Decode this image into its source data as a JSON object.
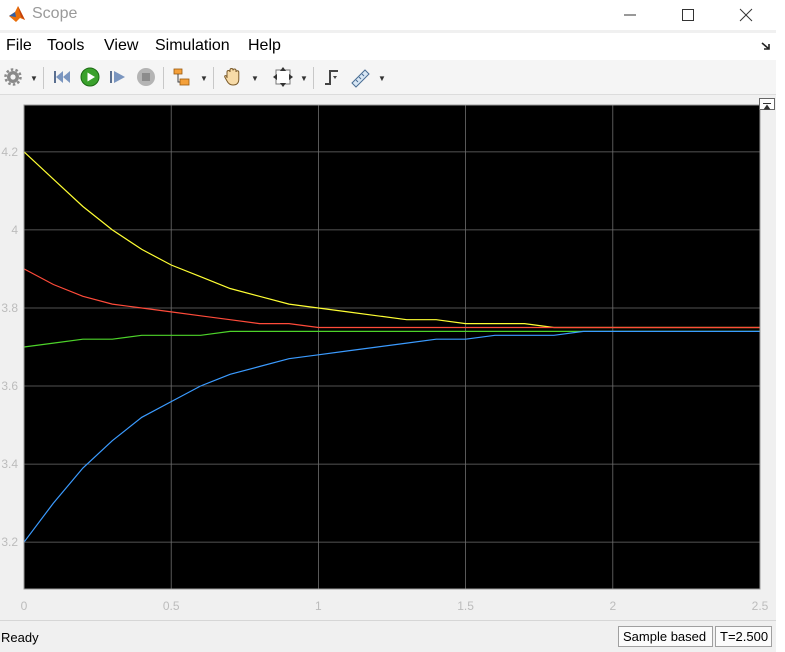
{
  "window": {
    "title": "Scope",
    "icons": {
      "app": "matlab-logo-icon",
      "minimize": "minimize-icon",
      "maximize": "maximize-icon",
      "close": "close-icon"
    }
  },
  "menu": {
    "items": [
      "File",
      "Tools",
      "View",
      "Simulation",
      "Help"
    ],
    "corner_icon": "dock-arrow-icon"
  },
  "toolbar": {
    "buttons": [
      "settings-gear-icon",
      "step-back-icon",
      "run-icon",
      "step-forward-icon",
      "stop-icon",
      "highlight-simulink-block-icon",
      "zoom-pan-hand-icon",
      "scale-axes-limits-icon",
      "triggers-icon",
      "measurements-ruler-icon"
    ]
  },
  "colors": {
    "plot_background": "#000000",
    "grid": "#6e6e6e",
    "tick_label": "#bcbcbc",
    "series": [
      "#ffff33",
      "#ff4b3a",
      "#4dd32a",
      "#3b9bff"
    ]
  },
  "chart_data": {
    "type": "line",
    "grid": true,
    "xlim": [
      0,
      2.5
    ],
    "ylim": [
      3.08,
      4.32
    ],
    "xticks": [
      0,
      0.5,
      1,
      1.5,
      2,
      2.5
    ],
    "xtick_labels": [
      "0",
      "0.5",
      "1",
      "1.5",
      "2",
      "2.5"
    ],
    "yticks": [
      3.2,
      3.4,
      3.6,
      3.8,
      4,
      4.2
    ],
    "ytick_labels": [
      "3.2",
      "3.4",
      "3.6",
      "3.8",
      "4",
      "4.2"
    ],
    "x": [
      0,
      0.1,
      0.2,
      0.3,
      0.4,
      0.5,
      0.6,
      0.7,
      0.8,
      0.9,
      1.0,
      1.1,
      1.2,
      1.3,
      1.4,
      1.5,
      1.6,
      1.7,
      1.8,
      1.9,
      2.0,
      2.1,
      2.2,
      2.3,
      2.4,
      2.5
    ],
    "series": [
      {
        "color": "#ffff33",
        "values": [
          4.2,
          4.13,
          4.06,
          4.0,
          3.95,
          3.91,
          3.88,
          3.85,
          3.83,
          3.81,
          3.8,
          3.79,
          3.78,
          3.77,
          3.77,
          3.76,
          3.76,
          3.76,
          3.75,
          3.75,
          3.75,
          3.75,
          3.75,
          3.75,
          3.75,
          3.75
        ]
      },
      {
        "color": "#ff4b3a",
        "values": [
          3.9,
          3.86,
          3.83,
          3.81,
          3.8,
          3.79,
          3.78,
          3.77,
          3.76,
          3.76,
          3.75,
          3.75,
          3.75,
          3.75,
          3.75,
          3.75,
          3.75,
          3.75,
          3.75,
          3.75,
          3.75,
          3.75,
          3.75,
          3.75,
          3.75,
          3.75
        ]
      },
      {
        "color": "#4dd32a",
        "values": [
          3.7,
          3.71,
          3.72,
          3.72,
          3.73,
          3.73,
          3.73,
          3.74,
          3.74,
          3.74,
          3.74,
          3.74,
          3.74,
          3.74,
          3.74,
          3.74,
          3.74,
          3.74,
          3.74,
          3.74,
          3.74,
          3.74,
          3.74,
          3.74,
          3.74,
          3.74
        ]
      },
      {
        "color": "#3b9bff",
        "values": [
          3.2,
          3.3,
          3.39,
          3.46,
          3.52,
          3.56,
          3.6,
          3.63,
          3.65,
          3.67,
          3.68,
          3.69,
          3.7,
          3.71,
          3.72,
          3.72,
          3.73,
          3.73,
          3.73,
          3.74,
          3.74,
          3.74,
          3.74,
          3.74,
          3.74,
          3.74
        ]
      }
    ]
  },
  "status": {
    "ready": "Ready",
    "sample_mode": "Sample based",
    "time": "T=2.500"
  }
}
